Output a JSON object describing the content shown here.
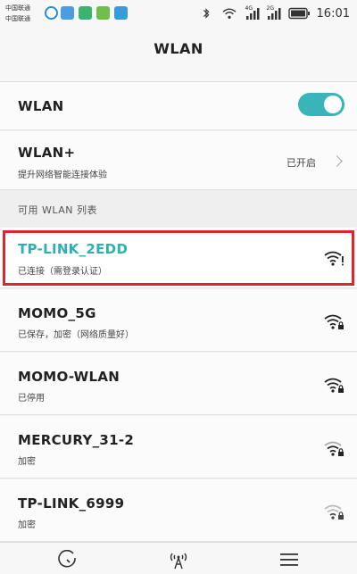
{
  "status_bar": {
    "carrier_1": "中国联通",
    "carrier_2": "中国联通",
    "time": "16:01",
    "network_1": "4G",
    "network_2": "2G"
  },
  "header": {
    "title": "WLAN"
  },
  "wlan_row": {
    "label": "WLAN",
    "toggle_on": true
  },
  "wlan_plus": {
    "label": "WLAN+",
    "subtitle": "提升网络智能连接体验",
    "status": "已开启"
  },
  "section_label": "可用 WLAN 列表",
  "networks": [
    {
      "ssid": "TP-LINK_2EDD",
      "status": "已连接（需登录认证）",
      "highlighted": true,
      "ssid_color": "#2bb0b5"
    },
    {
      "ssid": "MOMO_5G",
      "status": "已保存，加密（网络质量好）"
    },
    {
      "ssid": "MOMO-WLAN",
      "status": "已停用"
    },
    {
      "ssid": "MERCURY_31-2",
      "status": "加密"
    },
    {
      "ssid": "TP-LINK_6999",
      "status": "加密"
    }
  ],
  "colors": {
    "accent": "#39b5b9",
    "highlight_border": "#e0242b"
  },
  "bottom_nav": [
    "clock-icon",
    "wifi-tower-icon",
    "menu-icon"
  ]
}
